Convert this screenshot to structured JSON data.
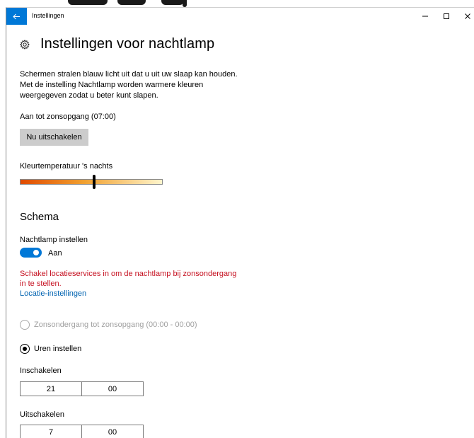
{
  "window": {
    "title": "Instellingen",
    "back_icon": "back-arrow-icon",
    "minimize": "−",
    "maximize": "☐",
    "close": "✕"
  },
  "header": {
    "icon": "gear-icon",
    "title": "Instellingen voor nachtlamp"
  },
  "description": "Schermen stralen blauw licht uit dat u uit uw slaap kan houden. Met de instelling Nachtlamp worden warmere kleuren weergegeven zodat u beter kunt slapen.",
  "status": "Aan tot zonsopgang (07:00)",
  "turn_off_button": "Nu uitschakelen",
  "color_temperature": {
    "label": "Kleurtemperatuur 's nachts",
    "value_fraction": 0.52
  },
  "schedule": {
    "title": "Schema",
    "toggle_label": "Nachtlamp instellen",
    "toggle_state": "Aan",
    "toggle_on": true,
    "warning": "Schakel locatieservices in om de nachtlamp bij zonsondergang in te stellen.",
    "link": "Locatie-instellingen",
    "options": [
      {
        "label": "Zonsondergang tot zonsopgang (00:00 - 00:00)",
        "selected": false,
        "disabled": true
      },
      {
        "label": "Uren instellen",
        "selected": true,
        "disabled": false
      }
    ],
    "on_time": {
      "label": "Inschakelen",
      "hour": "21",
      "minute": "00"
    },
    "off_time": {
      "label": "Uitschakelen",
      "hour": "7",
      "minute": "00"
    }
  },
  "colors": {
    "accent": "#0078d7",
    "warning": "#c50f1f",
    "link": "#0063b1"
  }
}
